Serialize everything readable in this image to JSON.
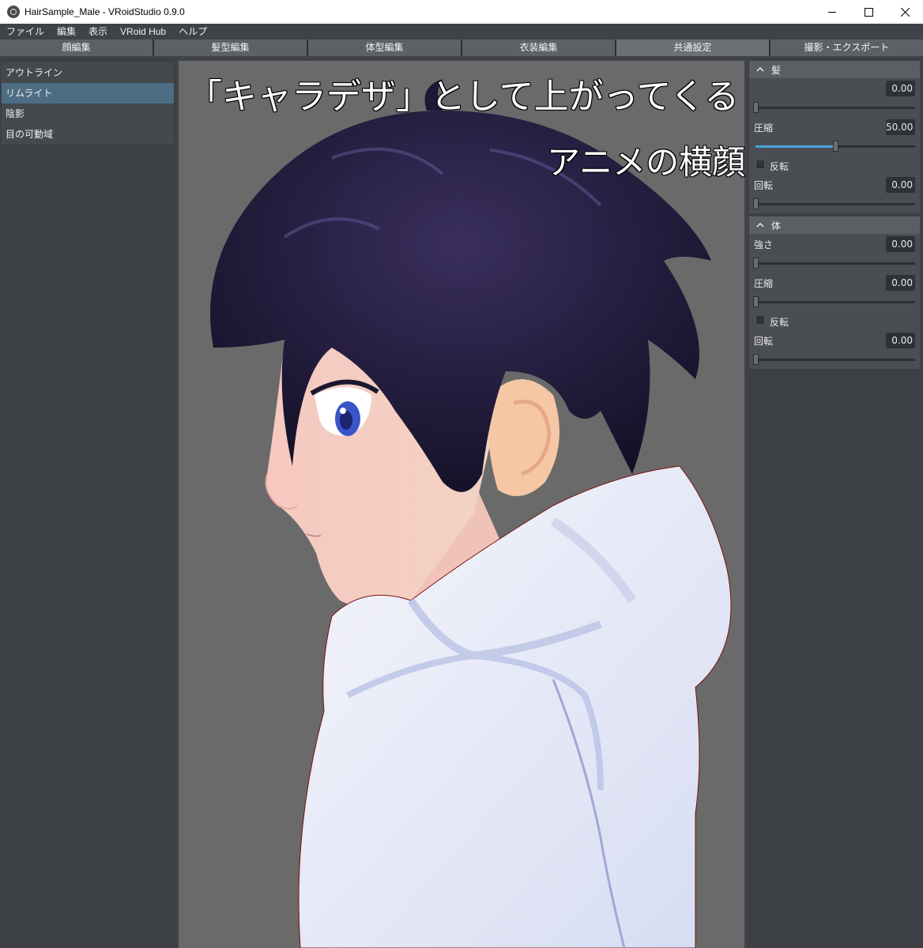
{
  "window": {
    "title": "HairSample_Male - VRoidStudio 0.9.0"
  },
  "menu": [
    "ファイル",
    "編集",
    "表示",
    "VRoid Hub",
    "ヘルプ"
  ],
  "tabs": [
    {
      "label": "顔編集",
      "active": false
    },
    {
      "label": "髪型編集",
      "active": false
    },
    {
      "label": "体型編集",
      "active": false
    },
    {
      "label": "衣装編集",
      "active": false
    },
    {
      "label": "共通設定",
      "active": true
    },
    {
      "label": "撮影・エクスポート",
      "active": false
    }
  ],
  "left_panel": {
    "items": [
      {
        "label": "アウトライン",
        "selected": false
      },
      {
        "label": "リムライト",
        "selected": true
      },
      {
        "label": "陰影",
        "selected": false
      },
      {
        "label": "目の可動域",
        "selected": false
      }
    ]
  },
  "overlay": {
    "caption1": "「キャラデザ」として上がってくる",
    "caption2": "アニメの横顔"
  },
  "right_panel": {
    "hair": {
      "title": "髪",
      "strength_value": "0.00",
      "strength_level": 0,
      "compress_label": "圧縮",
      "compress_value": "50.00",
      "compress_level": 0.5,
      "invert_label": "反転",
      "rotate_label": "回転",
      "rotate_value": "0.00",
      "rotate_level": 0
    },
    "body": {
      "title": "体",
      "strength_label": "強さ",
      "strength_value": "0.00",
      "strength_level": 0,
      "compress_label": "圧縮",
      "compress_value": "0.00",
      "compress_level": 0,
      "invert_label": "反転",
      "rotate_label": "回転",
      "rotate_value": "0.00",
      "rotate_level": 0
    }
  },
  "colors": {
    "accent": "#4aa3dc",
    "selected_item": "#4d6d84",
    "viewport_bg": "#6a6a6a",
    "hair": "#1a1533",
    "hoodie": "#eef0fa"
  },
  "icons": [
    "app-logo-icon",
    "minimize-icon",
    "maximize-icon",
    "close-icon",
    "chevron-up-icon"
  ]
}
